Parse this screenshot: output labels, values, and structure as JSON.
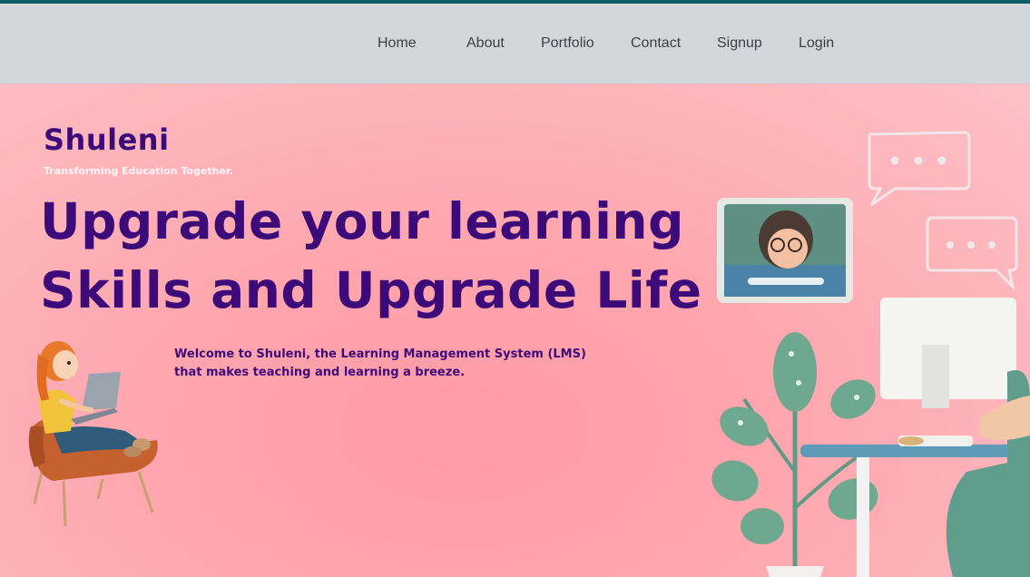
{
  "nav": {
    "items": [
      {
        "label": "Home"
      },
      {
        "label": "About"
      },
      {
        "label": "Portfolio"
      },
      {
        "label": "Contact"
      },
      {
        "label": "Signup"
      },
      {
        "label": "Login"
      }
    ]
  },
  "brand": {
    "name": "Shuleni",
    "tagline": "Transforming Education Together."
  },
  "hero": {
    "headline_line1": "Upgrade your learning",
    "headline_line2": "Skills and Upgrade Life",
    "welcome_line1": "Welcome to Shuleni, the Learning Management System (LMS)",
    "welcome_line2": "that makes teaching and learning a breeze."
  },
  "colors": {
    "accent_bar": "#0f5f67",
    "navbar_bg": "#d2d6dd",
    "headline": "#3d0a7a",
    "hero_bg": "#fcb7be"
  },
  "illustrations": {
    "left": "girl-reading-laptop-illustration",
    "right": "online-learning-desk-illustration"
  }
}
